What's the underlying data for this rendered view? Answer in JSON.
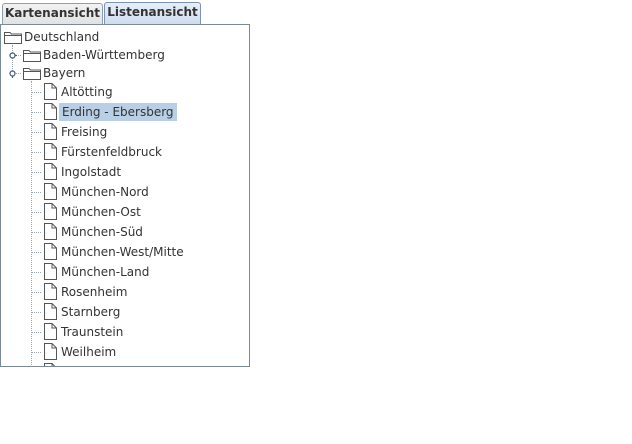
{
  "tabs": [
    {
      "label": "Kartenansicht",
      "active": false
    },
    {
      "label": "Listenansicht",
      "active": true
    }
  ],
  "tree": {
    "root": {
      "label": "Deutschland",
      "icon": "folder-icon"
    },
    "states": [
      {
        "label": "Baden-Württemberg",
        "icon": "folder-icon",
        "expanded": false
      },
      {
        "label": "Bayern",
        "icon": "folder-icon",
        "expanded": true
      }
    ],
    "bayern_children": [
      {
        "label": "Altötting",
        "icon": "document-icon",
        "selected": false
      },
      {
        "label": "Erding - Ebersberg",
        "icon": "document-icon",
        "selected": true
      },
      {
        "label": "Freising",
        "icon": "document-icon",
        "selected": false
      },
      {
        "label": "Fürstenfeldbruck",
        "icon": "document-icon",
        "selected": false
      },
      {
        "label": "Ingolstadt",
        "icon": "document-icon",
        "selected": false
      },
      {
        "label": "München-Nord",
        "icon": "document-icon",
        "selected": false
      },
      {
        "label": "München-Ost",
        "icon": "document-icon",
        "selected": false
      },
      {
        "label": "München-Süd",
        "icon": "document-icon",
        "selected": false
      },
      {
        "label": "München-West/Mitte",
        "icon": "document-icon",
        "selected": false
      },
      {
        "label": "München-Land",
        "icon": "document-icon",
        "selected": false
      },
      {
        "label": "Rosenheim",
        "icon": "document-icon",
        "selected": false
      },
      {
        "label": "Starnberg",
        "icon": "document-icon",
        "selected": false
      },
      {
        "label": "Traunstein",
        "icon": "document-icon",
        "selected": false
      },
      {
        "label": "Weilheim",
        "icon": "document-icon",
        "selected": false
      }
    ]
  },
  "colors": {
    "selection": "#b8cfe5",
    "active_tab": "#cfdcef",
    "panel_border": "#7a8a99"
  }
}
